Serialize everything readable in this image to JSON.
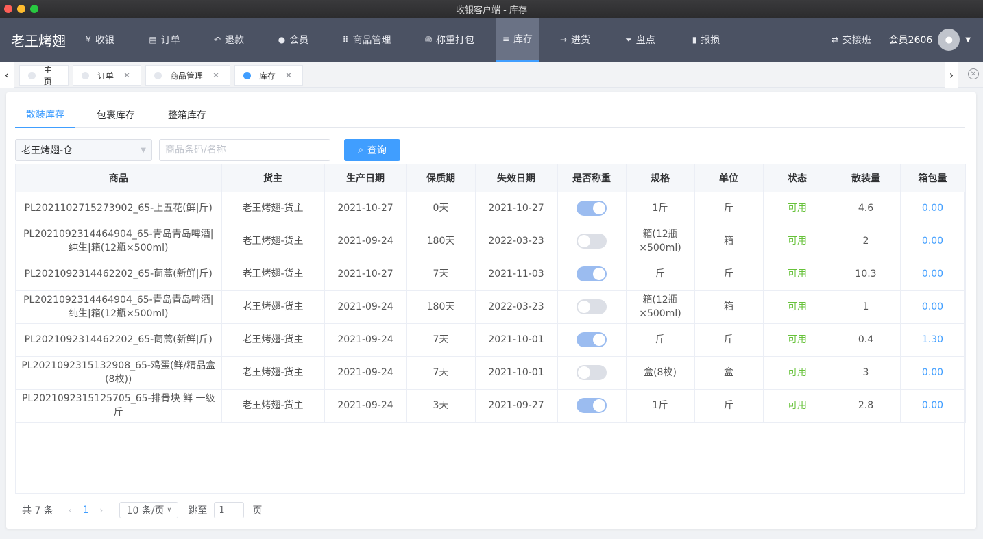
{
  "window": {
    "title": "收银客户端 - 库存"
  },
  "topnav": {
    "brand": "老王烤翅",
    "items": [
      {
        "icon": "yen-icon",
        "glyph": "¥",
        "label": "收银"
      },
      {
        "icon": "receipt-icon",
        "glyph": "▤",
        "label": "订单"
      },
      {
        "icon": "undo-icon",
        "glyph": "↶",
        "label": "退款"
      },
      {
        "icon": "user-icon",
        "glyph": "●",
        "label": "会员"
      },
      {
        "icon": "grid-icon",
        "glyph": "⠿",
        "label": "商品管理"
      },
      {
        "icon": "basket-icon",
        "glyph": "⛃",
        "label": "称重打包"
      },
      {
        "icon": "list-icon",
        "glyph": "≡",
        "label": "库存"
      },
      {
        "icon": "arrow-right-icon",
        "glyph": "→",
        "label": "进货"
      },
      {
        "icon": "filter-icon",
        "glyph": "⏷",
        "label": "盘点"
      },
      {
        "icon": "trash-icon",
        "glyph": "▮",
        "label": "报损"
      }
    ],
    "active_index": 6,
    "shift_change": {
      "icon": "swap-icon",
      "glyph": "⇄",
      "label": "交接班"
    },
    "user": {
      "label": "会员2606"
    }
  },
  "tabs": [
    {
      "label": "主页",
      "closable": false,
      "active": false
    },
    {
      "label": "订单",
      "closable": true,
      "active": false
    },
    {
      "label": "商品管理",
      "closable": true,
      "active": false
    },
    {
      "label": "库存",
      "closable": true,
      "active": true
    }
  ],
  "subtabs": [
    "散装库存",
    "包裹库存",
    "整箱库存"
  ],
  "subtab_active": 0,
  "filters": {
    "warehouse": "老王烤翅-仓",
    "search_placeholder": "商品条码/名称",
    "query_label": "查询"
  },
  "table": {
    "columns": [
      "商品",
      "货主",
      "生产日期",
      "保质期",
      "失效日期",
      "是否称重",
      "规格",
      "单位",
      "状态",
      "散装量",
      "箱包量"
    ],
    "rows": [
      {
        "product": "PL2021102715273902_65-上五花(鲜|斤)",
        "owner": "老王烤翅-货主",
        "prod_date": "2021-10-27",
        "shelf_life": "0天",
        "expiry": "2021-10-27",
        "weighed": true,
        "spec": "1斤",
        "unit": "斤",
        "status": "可用",
        "bulk_qty": "4.6",
        "box_qty": "0.00"
      },
      {
        "product": "PL2021092314464904_65-青岛青岛啤酒|纯生|箱(12瓶×500ml)",
        "owner": "老王烤翅-货主",
        "prod_date": "2021-09-24",
        "shelf_life": "180天",
        "expiry": "2022-03-23",
        "weighed": false,
        "spec": "箱(12瓶×500ml)",
        "unit": "箱",
        "status": "可用",
        "bulk_qty": "2",
        "box_qty": "0.00"
      },
      {
        "product": "PL2021092314462202_65-茼蒿(新鲜|斤)",
        "owner": "老王烤翅-货主",
        "prod_date": "2021-10-27",
        "shelf_life": "7天",
        "expiry": "2021-11-03",
        "weighed": true,
        "spec": "斤",
        "unit": "斤",
        "status": "可用",
        "bulk_qty": "10.3",
        "box_qty": "0.00"
      },
      {
        "product": "PL2021092314464904_65-青岛青岛啤酒|纯生|箱(12瓶×500ml)",
        "owner": "老王烤翅-货主",
        "prod_date": "2021-09-24",
        "shelf_life": "180天",
        "expiry": "2022-03-23",
        "weighed": false,
        "spec": "箱(12瓶×500ml)",
        "unit": "箱",
        "status": "可用",
        "bulk_qty": "1",
        "box_qty": "0.00"
      },
      {
        "product": "PL2021092314462202_65-茼蒿(新鲜|斤)",
        "owner": "老王烤翅-货主",
        "prod_date": "2021-09-24",
        "shelf_life": "7天",
        "expiry": "2021-10-01",
        "weighed": true,
        "spec": "斤",
        "unit": "斤",
        "status": "可用",
        "bulk_qty": "0.4",
        "box_qty": "1.30"
      },
      {
        "product": "PL2021092315132908_65-鸡蛋(鲜/精品盒(8枚))",
        "owner": "老王烤翅-货主",
        "prod_date": "2021-09-24",
        "shelf_life": "7天",
        "expiry": "2021-10-01",
        "weighed": false,
        "spec": "盒(8枚)",
        "unit": "盒",
        "status": "可用",
        "bulk_qty": "3",
        "box_qty": "0.00"
      },
      {
        "product": "PL2021092315125705_65-排骨块 鲜 一级斤",
        "owner": "老王烤翅-货主",
        "prod_date": "2021-09-24",
        "shelf_life": "3天",
        "expiry": "2021-09-27",
        "weighed": true,
        "spec": "1斤",
        "unit": "斤",
        "status": "可用",
        "bulk_qty": "2.8",
        "box_qty": "0.00"
      }
    ]
  },
  "pagination": {
    "total_label": "共 7 条",
    "current_page": "1",
    "page_size_label": "10 条/页",
    "jump_label": "跳至",
    "jump_value": "1",
    "page_suffix": "页"
  },
  "colors": {
    "accent": "#409eff",
    "nav_bg": "#4b5263",
    "status_ok": "#67c23a"
  }
}
